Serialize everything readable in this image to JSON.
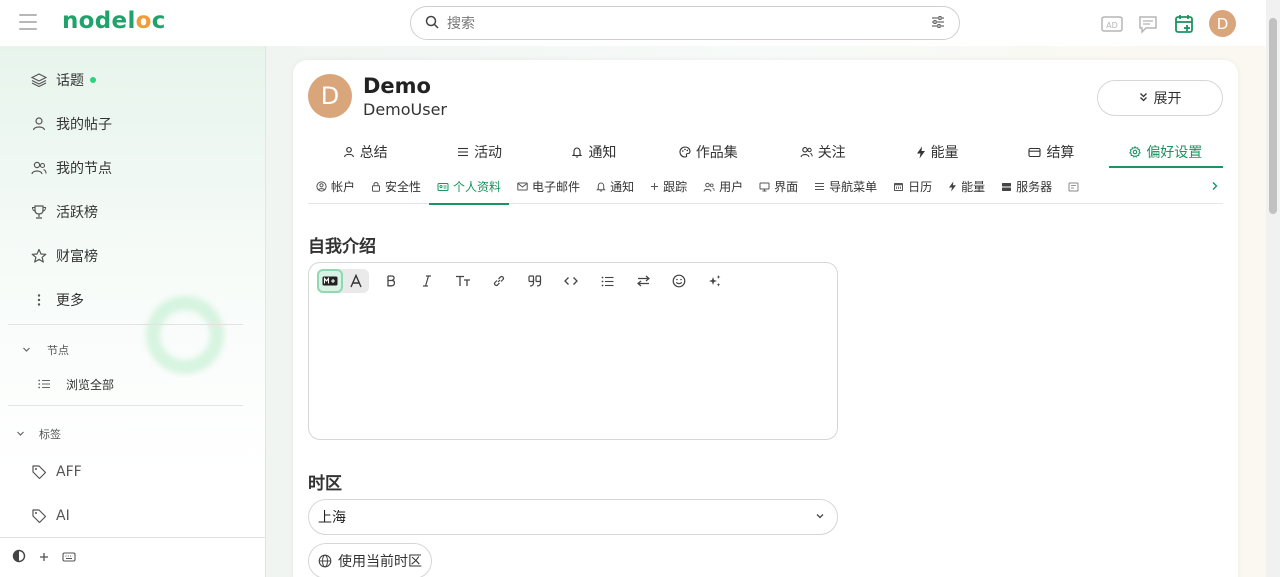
{
  "header": {
    "logo": {
      "part1": "nodel",
      "part2": "o",
      "part3": "c"
    },
    "search_placeholder": "搜索",
    "avatar_letter": "D"
  },
  "sidebar": {
    "items": [
      {
        "label": "话题",
        "icon": "layers-icon",
        "has_dot": true
      },
      {
        "label": "我的帖子",
        "icon": "user-icon"
      },
      {
        "label": "我的节点",
        "icon": "users-icon"
      },
      {
        "label": "活跃榜",
        "icon": "trophy-icon"
      },
      {
        "label": "财富榜",
        "icon": "star-icon"
      },
      {
        "label": "更多",
        "icon": "more-icon"
      }
    ],
    "nodes_section": "节点",
    "browse_all": "浏览全部",
    "tags_section": "标签",
    "tags": [
      "AFF",
      "AI"
    ]
  },
  "profile": {
    "avatar_letter": "D",
    "name": "Demo",
    "username": "DemoUser",
    "expand_label": "展开"
  },
  "tabs": [
    {
      "label": "总结",
      "icon": "user-icon"
    },
    {
      "label": "活动",
      "icon": "list-icon"
    },
    {
      "label": "通知",
      "icon": "bell-icon"
    },
    {
      "label": "作品集",
      "icon": "palette-icon"
    },
    {
      "label": "关注",
      "icon": "users-icon"
    },
    {
      "label": "能量",
      "icon": "bolt-icon"
    },
    {
      "label": "结算",
      "icon": "card-icon"
    },
    {
      "label": "偏好设置",
      "icon": "gear-icon",
      "active": true
    }
  ],
  "subtabs": [
    {
      "label": "帐户",
      "icon": "account-icon"
    },
    {
      "label": "安全性",
      "icon": "lock-icon"
    },
    {
      "label": "个人资料",
      "icon": "id-card-icon",
      "active": true
    },
    {
      "label": "电子邮件",
      "icon": "mail-icon"
    },
    {
      "label": "通知",
      "icon": "bell-icon"
    },
    {
      "label": "跟踪",
      "icon": "plus-icon"
    },
    {
      "label": "用户",
      "icon": "users-icon"
    },
    {
      "label": "界面",
      "icon": "monitor-icon"
    },
    {
      "label": "导航菜单",
      "icon": "menu-icon"
    },
    {
      "label": "日历",
      "icon": "calendar-icon"
    },
    {
      "label": "能量",
      "icon": "bolt-icon"
    },
    {
      "label": "服务器",
      "icon": "server-icon"
    }
  ],
  "bio": {
    "title": "自我介绍"
  },
  "timezone": {
    "title": "时区",
    "selected": "上海",
    "use_current_label": "使用当前时区"
  },
  "colors": {
    "accent": "#1a9460",
    "logo_green": "#1fa36a",
    "logo_orange": "#f29b38",
    "avatar": "#d9a57b"
  }
}
